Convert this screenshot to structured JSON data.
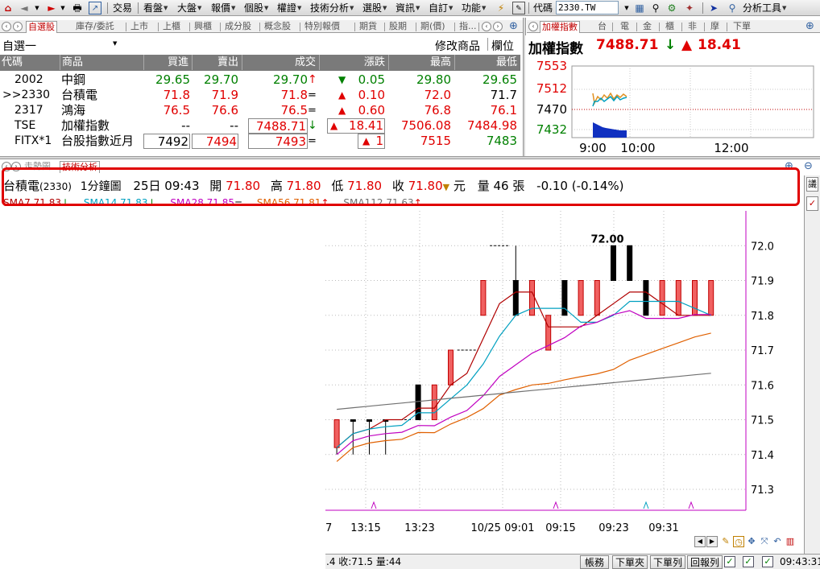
{
  "toolbar": {
    "items": [
      "交易",
      "看盤",
      "大盤",
      "報價",
      "個股",
      "權證",
      "技術分析",
      "選股",
      "資訊",
      "自訂",
      "功能"
    ],
    "symbol_label": "代碼",
    "symbol_value": "2330.TW",
    "analysis_tools": "分析工具"
  },
  "tabs_left": [
    "自選股",
    "庫存/委託",
    "上市",
    "上櫃",
    "興櫃",
    "成分股",
    "概念股",
    "特別報價",
    "期貨",
    "股期",
    "期(價)",
    "指..."
  ],
  "tabs_right": [
    "加權指數",
    "台",
    "電",
    "金",
    "櫃",
    "非",
    "摩",
    "下單"
  ],
  "watchlist": {
    "name": "自選一",
    "edit_label": "修改商品",
    "columns_label": "欄位",
    "headers": [
      "代碼",
      "商品",
      "買進",
      "賣出",
      "成交",
      "漲跌",
      "最高",
      "最低"
    ],
    "rows": [
      {
        "code": "2002",
        "name": "中鋼",
        "bid": "29.65",
        "ask": "29.70",
        "last": "29.70",
        "last_mark": "↑",
        "chg": "0.05",
        "chg_dir": "down",
        "high": "29.80",
        "low": "29.65"
      },
      {
        "code": ">>2330",
        "name": "台積電",
        "bid": "71.8",
        "ask": "71.9",
        "last": "71.8",
        "last_mark": "=",
        "chg": "0.10",
        "chg_dir": "up",
        "high": "72.0",
        "low": "71.7"
      },
      {
        "code": "2317",
        "name": "鴻海",
        "bid": "76.5",
        "ask": "76.6",
        "last": "76.5",
        "last_mark": "=",
        "chg": "0.60",
        "chg_dir": "up",
        "high": "76.8",
        "low": "76.1"
      },
      {
        "code": "TSE",
        "name": "加權指數",
        "bid": "--",
        "ask": "--",
        "last": "7488.71",
        "last_mark": "↓",
        "chg": "18.41",
        "chg_dir": "up",
        "high": "7506.08",
        "low": "7484.98"
      },
      {
        "code": "FITX*1",
        "name": "台股指數近月",
        "bid": "7492",
        "ask": "7494",
        "last": "7493",
        "last_mark": "=",
        "chg": "1",
        "chg_dir": "up",
        "high": "7515",
        "low": "7483"
      }
    ]
  },
  "index_panel": {
    "title": "加權指數",
    "value": "7488.71",
    "value_mark": "↓",
    "change": "18.41",
    "y_ticks": [
      "7553",
      "7512",
      "7470",
      "7432"
    ],
    "x_ticks": [
      "9:00",
      "10:00",
      "12:00"
    ]
  },
  "chart_tabs": [
    "走勢圖",
    "技術分析"
  ],
  "quote_bar": {
    "name": "台積電",
    "code": "(2330)",
    "period": "1分鐘圖",
    "date": "25日",
    "time": "09:43",
    "open_label": "開",
    "open": "71.80",
    "high_label": "高",
    "high": "71.80",
    "low_label": "低",
    "low": "71.80",
    "close_label": "收",
    "close": "71.80",
    "unit": "元",
    "volume_label": "量",
    "volume": "46",
    "volume_unit": "張",
    "change": "-0.10 (-0.14%)"
  },
  "sma_legend": [
    {
      "label": "SMA7 71.83",
      "mark": "↓",
      "color": "#b00000"
    },
    {
      "label": "SMA14 71.83",
      "mark": "↓",
      "color": "#00a0c0"
    },
    {
      "label": "SMA28 71.85",
      "mark": "=",
      "color": "#c000c0"
    },
    {
      "label": "SMA56 71.81",
      "mark": "↑",
      "color": "#e06000"
    },
    {
      "label": "SMA112 71.63",
      "mark": "↑",
      "color": "#707070"
    }
  ],
  "chart_data": {
    "type": "candlestick",
    "title": "台積電(2330) 1分鐘圖",
    "y_ticks": [
      "72.0",
      "71.9",
      "71.8",
      "71.7",
      "71.6",
      "71.5",
      "71.4",
      "71.3"
    ],
    "ylim": [
      71.24,
      72.1
    ],
    "x_ticks": [
      "7",
      "13:15",
      "13:23",
      "10/25 09:01",
      "09:15",
      "09:23",
      "09:31"
    ],
    "annotation": "72.00",
    "candles": [
      {
        "o": 71.5,
        "c": 71.42,
        "h": 71.5,
        "l": 71.4,
        "col": "red"
      },
      {
        "o": 71.5,
        "c": 71.5,
        "h": 71.5,
        "l": 71.4,
        "col": "blk"
      },
      {
        "o": 71.5,
        "c": 71.5,
        "h": 71.5,
        "l": 71.4,
        "col": "blk"
      },
      {
        "o": 71.5,
        "c": 71.5,
        "h": 71.5,
        "l": 71.4,
        "col": "blk"
      },
      {
        "o": 71.5,
        "c": 71.5,
        "h": 71.5,
        "l": 71.5,
        "col": "dash"
      },
      {
        "o": 71.5,
        "c": 71.6,
        "h": 71.6,
        "l": 71.5,
        "col": "blk"
      },
      {
        "o": 71.6,
        "c": 71.5,
        "h": 71.6,
        "l": 71.5,
        "col": "red"
      },
      {
        "o": 71.6,
        "c": 71.7,
        "h": 71.7,
        "l": 71.6,
        "col": "red"
      },
      {
        "o": 71.7,
        "c": 71.7,
        "h": 71.7,
        "l": 71.7,
        "col": "dash"
      },
      {
        "o": 71.9,
        "c": 71.8,
        "h": 71.9,
        "l": 71.8,
        "col": "red"
      },
      {
        "o": 72.0,
        "c": 72.0,
        "h": 72.0,
        "l": 72.0,
        "col": "dash"
      },
      {
        "o": 71.9,
        "c": 71.8,
        "h": 72.0,
        "l": 71.8,
        "col": "blk"
      },
      {
        "o": 71.9,
        "c": 71.8,
        "h": 71.9,
        "l": 71.8,
        "col": "red"
      },
      {
        "o": 71.8,
        "c": 71.7,
        "h": 71.8,
        "l": 71.7,
        "col": "red"
      },
      {
        "o": 71.9,
        "c": 71.8,
        "h": 71.9,
        "l": 71.8,
        "col": "blk"
      },
      {
        "o": 71.9,
        "c": 71.8,
        "h": 71.9,
        "l": 71.8,
        "col": "red"
      },
      {
        "o": 71.9,
        "c": 71.8,
        "h": 71.9,
        "l": 71.8,
        "col": "red"
      },
      {
        "o": 72.0,
        "c": 71.9,
        "h": 72.0,
        "l": 71.9,
        "col": "blk"
      },
      {
        "o": 72.0,
        "c": 71.9,
        "h": 72.0,
        "l": 71.9,
        "col": "blk"
      },
      {
        "o": 71.9,
        "c": 71.8,
        "h": 71.9,
        "l": 71.8,
        "col": "blk"
      },
      {
        "o": 71.9,
        "c": 71.8,
        "h": 71.9,
        "l": 71.8,
        "col": "red"
      },
      {
        "o": 71.9,
        "c": 71.8,
        "h": 71.9,
        "l": 71.8,
        "col": "red"
      },
      {
        "o": 71.9,
        "c": 71.8,
        "h": 71.9,
        "l": 71.8,
        "col": "red"
      },
      {
        "o": 71.9,
        "c": 71.8,
        "h": 71.9,
        "l": 71.8,
        "col": "red"
      }
    ]
  },
  "bottom_bar": {
    "left_text": ".4 收:71.5 量:44",
    "buttons": [
      "帳務",
      "下單夾",
      "下單列",
      "回報列"
    ],
    "clock": "09:43:31"
  },
  "colors": {
    "accent_red": "#e00000",
    "accent_green": "#008000",
    "tab_active": "#c00000"
  }
}
